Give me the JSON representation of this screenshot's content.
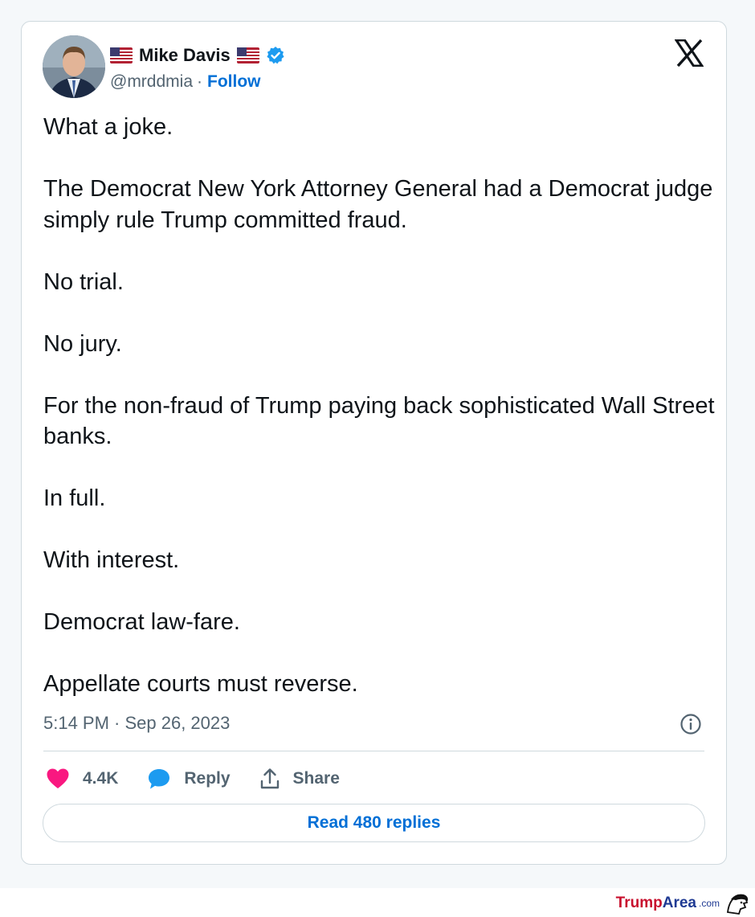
{
  "author": {
    "name": "Mike Davis",
    "handle": "@mrddmia",
    "separator": "·",
    "follow_label": "Follow",
    "flags": [
      "us-flag-icon",
      "us-flag-icon"
    ],
    "verified_color": "#1d9bf0"
  },
  "platform_icon": "x-logo-icon",
  "tweet": {
    "paragraphs": [
      "What a joke.",
      "The Democrat New York Attorney General had a Democrat judge simply rule Trump committed fraud.",
      "No trial.",
      "No jury.",
      "For the non-fraud of Trump paying back sophisticated Wall Street banks.",
      "In full.",
      "With interest.",
      "Democrat law-fare.",
      "Appellate courts must reverse."
    ],
    "timestamp": "5:14 PM · Sep 26, 2023"
  },
  "actions": {
    "likes": "4.4K",
    "reply_label": "Reply",
    "share_label": "Share"
  },
  "read_replies_label": "Read 480 replies",
  "watermark": {
    "trump": "Trump",
    "area": "Area",
    "com": ".com"
  },
  "colors": {
    "like": "#f91880",
    "reply": "#1d9bf0",
    "link": "#006fd6",
    "text": "#0f1419",
    "muted": "#536471"
  }
}
